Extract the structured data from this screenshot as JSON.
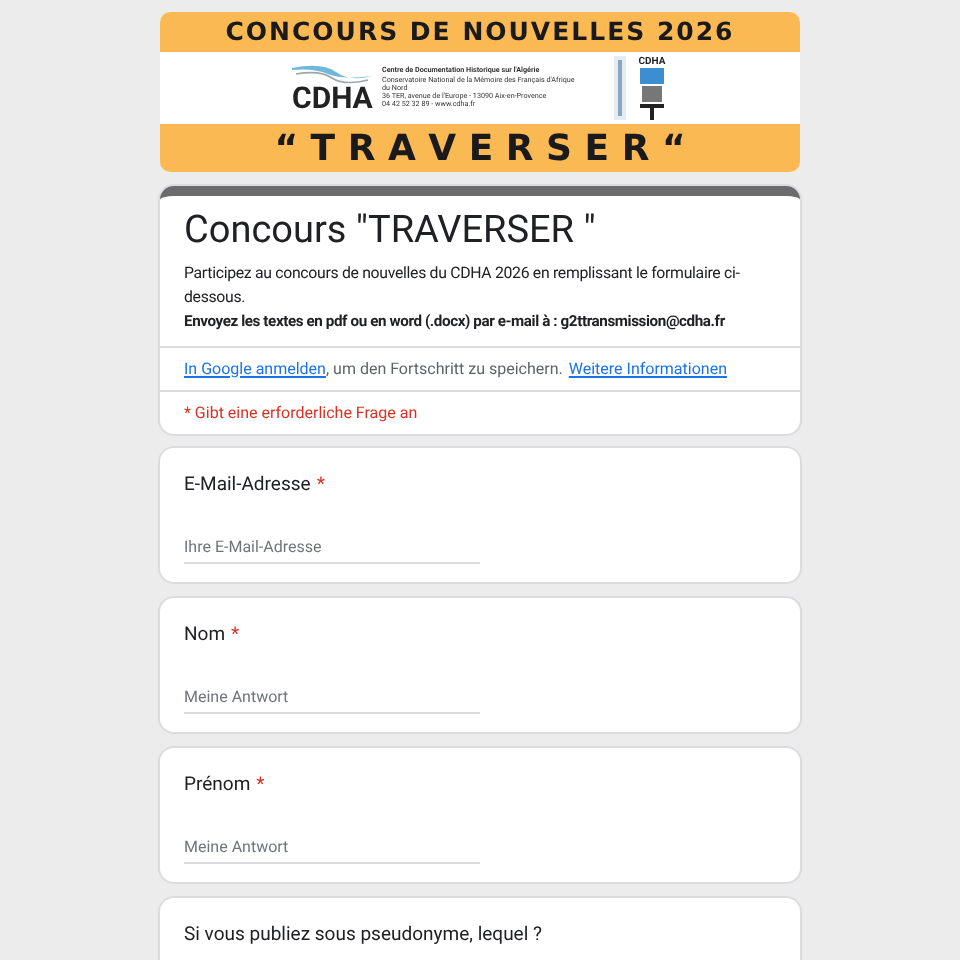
{
  "banner": {
    "heading": "CONCOURS DE NOUVELLES 2026",
    "logo_text": "CDHA",
    "org_name": "Centre de Documentation Historique sur l'Algérie",
    "org_lines": [
      "Conservatoire National de la Mémoire des Français d'Afrique du Nord",
      "36 TER, avenue de l'Europe - 13090 Aix-en-Provence",
      "04 42 52 32 89 - www.cdha.fr"
    ],
    "side_logo_text": "CDHA",
    "theme": "“ T R A V E R S E R “"
  },
  "form": {
    "title": "Concours \"TRAVERSER \"",
    "description": "Participez au concours de nouvelles du CDHA 2026 en remplissant le formulaire ci-dessous.",
    "instruction": "Envoyez les textes en pdf ou en word (.docx) par e-mail à :  g2ttransmission@cdha.fr",
    "signin_link": "In Google anmelden",
    "signin_text": ", um den Fortschritt zu speichern.",
    "more_link": "Weitere Informationen",
    "required_note": "* Gibt eine erforderliche Frage an"
  },
  "questions": [
    {
      "label": "E-Mail-Adresse",
      "required_mark": "*",
      "placeholder": "Ihre E-Mail-Adresse"
    },
    {
      "label": "Nom",
      "required_mark": "*",
      "placeholder": "Meine Antwort"
    },
    {
      "label": "Prénom",
      "required_mark": "*",
      "placeholder": "Meine Antwort"
    },
    {
      "label": "Si vous publiez sous pseudonyme, lequel ?"
    }
  ]
}
